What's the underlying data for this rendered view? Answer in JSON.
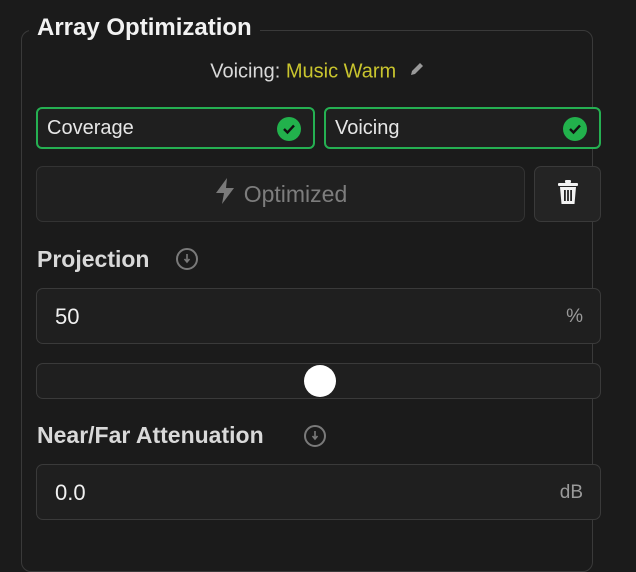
{
  "panel": {
    "title": "Array Optimization"
  },
  "voicing": {
    "label": "Voicing:",
    "value": "Music Warm"
  },
  "chips": [
    {
      "label": "Coverage",
      "checked": true
    },
    {
      "label": "Voicing",
      "checked": true
    }
  ],
  "optimize": {
    "label": "Optimized",
    "icon": "lightning-bolt-icon",
    "enabled": false
  },
  "delete": {
    "icon": "trash-icon"
  },
  "projection": {
    "label": "Projection",
    "value": "50",
    "unit": "%",
    "slider_fraction": 0.5
  },
  "attenuation": {
    "label": "Near/Far Attenuation",
    "value": "0.0",
    "unit": "dB"
  },
  "colors": {
    "accent_green": "#22b14c",
    "voicing_yellow": "#c9c52e",
    "background": "#1b1b1b"
  }
}
